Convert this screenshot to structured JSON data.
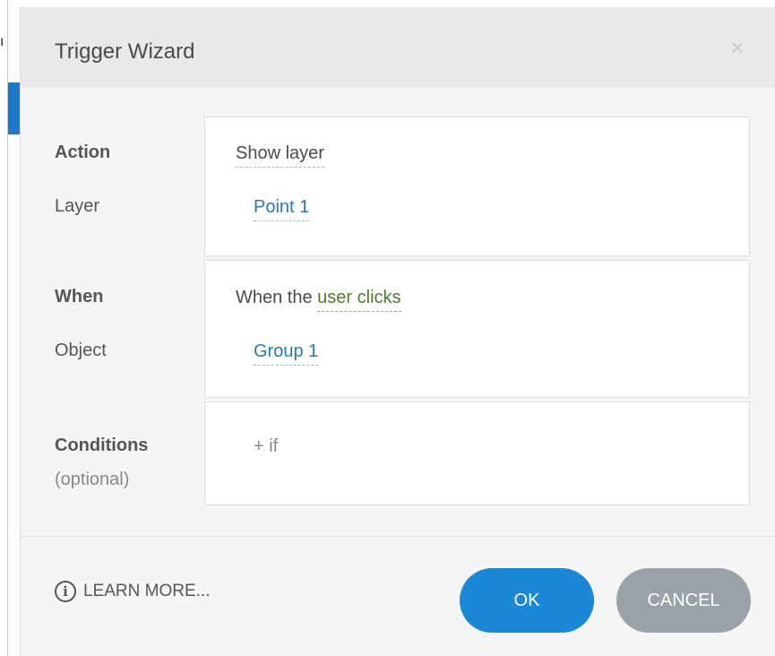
{
  "background": {
    "edge_char": "ı",
    "blue_tab_char": "‹"
  },
  "dialog": {
    "title": "Trigger Wizard",
    "close_icon": "×"
  },
  "action_section": {
    "action_label": "Action",
    "action_value": "Show layer",
    "layer_label": "Layer",
    "layer_value": "Point 1"
  },
  "when_section": {
    "when_label": "When",
    "when_prefix": "When the ",
    "when_value": "user clicks",
    "object_label": "Object",
    "object_value": "Group 1"
  },
  "conditions_section": {
    "label": "Conditions",
    "sublabel": "(optional)",
    "add_label": "+ if"
  },
  "footer": {
    "info_icon": "i",
    "learn_more": "LEARN MORE...",
    "ok_label": "OK",
    "cancel_label": "CANCEL"
  },
  "colors": {
    "primary": "#1a87d7",
    "cancel": "#9aa1a8",
    "link_blue": "#2a78b5",
    "link_green": "#4e7a2a",
    "header_bg": "#e8e9ea"
  }
}
